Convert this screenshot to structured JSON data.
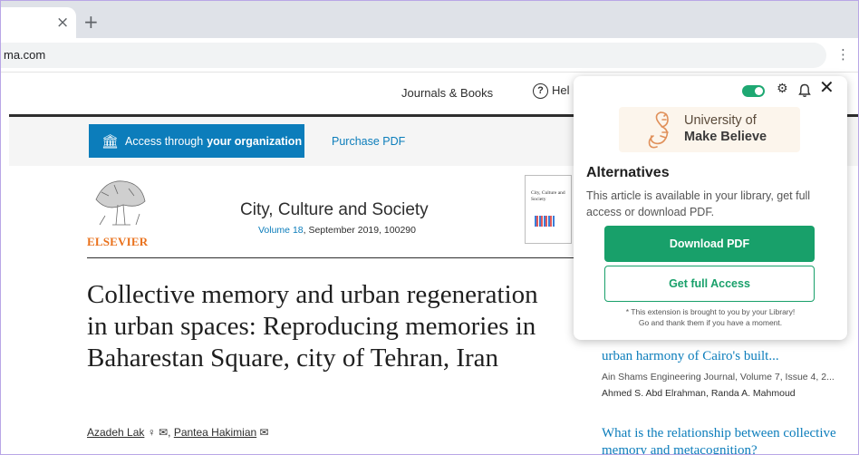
{
  "browser": {
    "tab_close": "×",
    "new_tab": "+",
    "url": "ma.com",
    "menu_glyph": "⋮"
  },
  "header": {
    "journals_books": "Journals & Books",
    "help_label": "Hel",
    "help_glyph": "?"
  },
  "access": {
    "access_prefix": "Access through",
    "access_bold": "your organization",
    "purchase_pdf": "Purchase PDF"
  },
  "journal": {
    "publisher": "ELSEVIER",
    "title": "City, Culture and Society",
    "volume": "Volume 18",
    "volume_rest": ", September 2019, 100290",
    "cover_text": "City, Culture and Society"
  },
  "article": {
    "title": "Collective memory and urban regeneration in urban spaces: Reproducing memories in Baharestan Square, city of Tehran, Iran",
    "author1": "Azadeh Lak",
    "author2": "Pantea Hakimian",
    "author_icons": "♀ ✉",
    "author2_icon": "✉",
    "separator": ","
  },
  "rail": {
    "item1_title": "urban harmony of Cairo's built...",
    "item1_source": "Ain Shams Engineering Journal, Volume 7, Issue 4, 2...",
    "item1_authors": "Ahmed S. Abd Elrahman, Randa A. Mahmoud",
    "item2_title": "What is the relationship between collective memory and metacognition?"
  },
  "extension": {
    "enabled": true,
    "gear_glyph": "⚙",
    "bell_glyph": "♫",
    "close_glyph": "✕",
    "university_line1": "University of",
    "university_line2": "Make Believe",
    "heading": "Alternatives",
    "description": "This article is available in your library, get full access or download PDF.",
    "download_pdf": "Download PDF",
    "get_full_access": "Get full Access",
    "footnote_line1": "* This extension is brought to you by your Library!",
    "footnote_line2": "Go and thank them if you have a moment.",
    "accent_color": "#18a06a"
  },
  "colors": {
    "elsevier_blue": "#0c7dbb",
    "elsevier_orange": "#e9711c"
  }
}
